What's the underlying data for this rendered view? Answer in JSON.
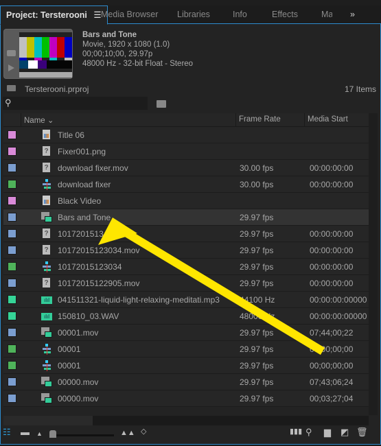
{
  "tabs": [
    {
      "label": "Project: Tersterooni",
      "active": true
    },
    {
      "label": "Media Browser"
    },
    {
      "label": "Libraries"
    },
    {
      "label": "Info"
    },
    {
      "label": "Effects"
    },
    {
      "label": "Ma"
    }
  ],
  "tab_menu_icon": "hamburger-icon",
  "overflow_icon": "double-chevron-right",
  "preview": {
    "title": "Bars and Tone",
    "line1": "Movie, 1920 x 1080 (1.0)",
    "line2": "00;00;10;00, 29.97p",
    "line3": "48000 Hz - 32-bit Float - Stereo"
  },
  "project": {
    "file": "Tersterooni.prproj",
    "count": "17 Items"
  },
  "search": {
    "value": "",
    "placeholder": ""
  },
  "columns": {
    "name": "Name",
    "frame_rate": "Frame Rate",
    "media_start": "Media Start"
  },
  "colors": {
    "pink": "#d98ad8",
    "blue": "#7b9ed0",
    "green": "#4fb35a",
    "teal": "#35d497",
    "accent": "#2d8ccf",
    "arrow": "#ffe600"
  },
  "rows": [
    {
      "label": "pink",
      "icon": "graphic",
      "name": "Title 06",
      "frame_rate": "",
      "media_start": ""
    },
    {
      "label": "pink",
      "icon": "offline",
      "name": "Fixer001.png",
      "frame_rate": "",
      "media_start": ""
    },
    {
      "label": "blue",
      "icon": "offline",
      "name": "download fixer.mov",
      "frame_rate": "30.00 fps",
      "media_start": "00:00:00:00"
    },
    {
      "label": "green",
      "icon": "sequence",
      "name": "download fixer",
      "frame_rate": "30.00 fps",
      "media_start": "00:00:00:00"
    },
    {
      "label": "pink",
      "icon": "graphic",
      "name": "Black Video",
      "frame_rate": "",
      "media_start": ""
    },
    {
      "label": "blue",
      "icon": "av",
      "name": "Bars and Tone",
      "frame_rate": "29.97 fps",
      "media_start": "",
      "selected": true
    },
    {
      "label": "blue",
      "icon": "offline",
      "name": "1017201513",
      "frame_rate": "29.97 fps",
      "media_start": "00:00:00:00"
    },
    {
      "label": "blue",
      "icon": "offline",
      "name": "10172015123034.mov",
      "frame_rate": "29.97 fps",
      "media_start": "00:00:00:00"
    },
    {
      "label": "green",
      "icon": "sequence",
      "name": "10172015123034",
      "frame_rate": "29.97 fps",
      "media_start": "00:00:00:00"
    },
    {
      "label": "blue",
      "icon": "offline",
      "name": "10172015122905.mov",
      "frame_rate": "29.97 fps",
      "media_start": "00:00:00:00"
    },
    {
      "label": "teal",
      "icon": "audio",
      "name": "041511321-liquid-light-relaxing-meditati.mp3",
      "frame_rate": "44100 Hz",
      "media_start": "00:00:00:00000"
    },
    {
      "label": "teal",
      "icon": "audio",
      "name": "150810_03.WAV",
      "frame_rate": "48000 Hz",
      "media_start": "00:00:00:00000"
    },
    {
      "label": "blue",
      "icon": "av",
      "name": "00001.mov",
      "frame_rate": "29.97 fps",
      "media_start": "07;44;00;22"
    },
    {
      "label": "green",
      "icon": "sequence",
      "name": "00001",
      "frame_rate": "29.97 fps",
      "media_start": "00;00;00;00"
    },
    {
      "label": "green",
      "icon": "sequence",
      "name": "00001",
      "frame_rate": "29.97 fps",
      "media_start": "00;00;00;00"
    },
    {
      "label": "blue",
      "icon": "av",
      "name": "00000.mov",
      "frame_rate": "29.97 fps",
      "media_start": "07;43;06;24"
    },
    {
      "label": "blue",
      "icon": "av",
      "name": "00000.mov",
      "frame_rate": "29.97 fps",
      "media_start": "00;03;27;04"
    }
  ],
  "zoom_slider": {
    "value": 0.05
  }
}
